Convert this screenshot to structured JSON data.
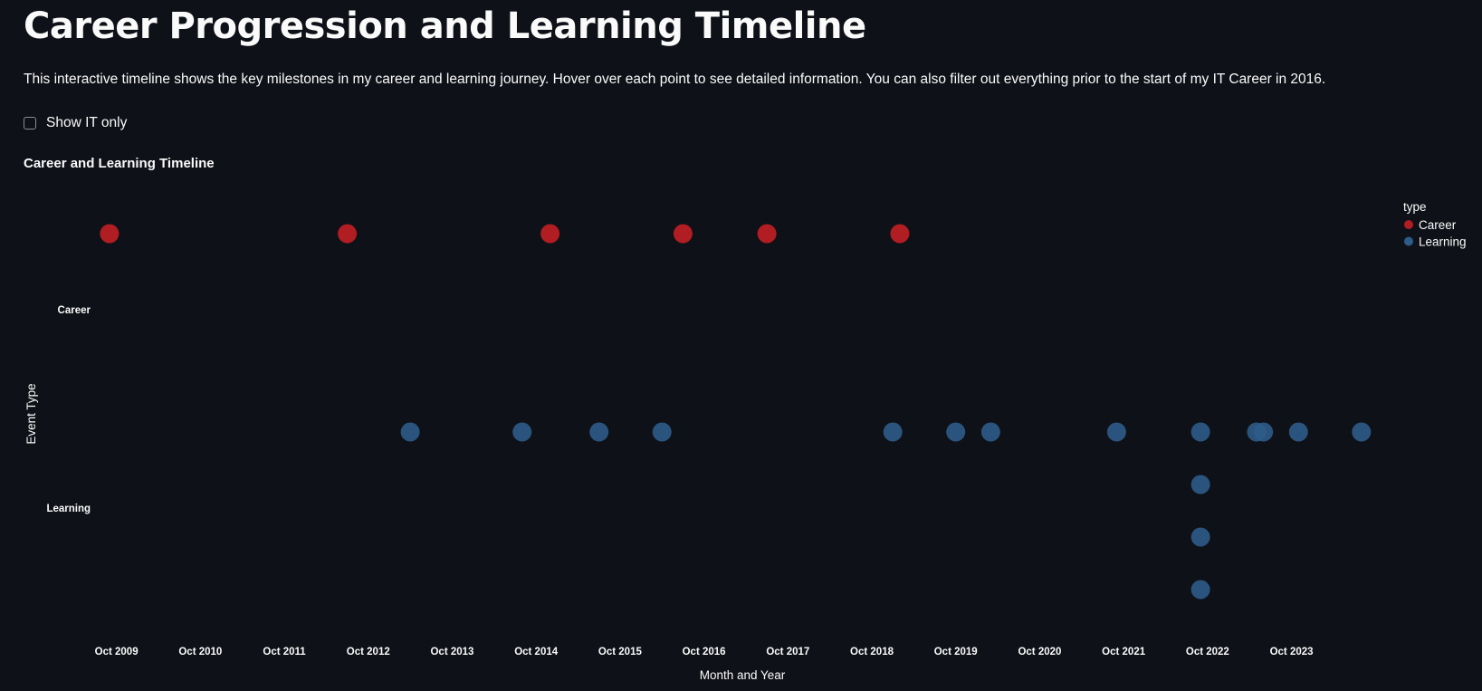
{
  "page": {
    "title": "Career Progression and Learning Timeline",
    "intro": "This interactive timeline shows the key milestones in my career and learning journey. Hover over each point to see detailed information. You can also filter out everything prior to the start of my IT Career in 2016.",
    "filter": {
      "label": "Show IT only",
      "checked": false
    }
  },
  "chart_data": {
    "type": "scatter",
    "title": "Career and Learning Timeline",
    "xlabel": "Month and Year",
    "ylabel": "Event Type",
    "x_ticks": [
      "Oct 2009",
      "Oct 2010",
      "Oct 2011",
      "Oct 2012",
      "Oct 2013",
      "Oct 2014",
      "Oct 2015",
      "Oct 2016",
      "Oct 2017",
      "Oct 2018",
      "Oct 2019",
      "Oct 2020",
      "Oct 2021",
      "Oct 2022",
      "Oct 2023"
    ],
    "xlim": [
      "2009-05",
      "2024-11"
    ],
    "y_categories": [
      "Career",
      "Learning"
    ],
    "grid": false,
    "legend": {
      "title": "type",
      "position": "top-right"
    },
    "series": [
      {
        "name": "Career",
        "color": "#b01d22",
        "points": [
          {
            "x": "2009-09",
            "row": 0
          },
          {
            "x": "2012-07",
            "row": 0
          },
          {
            "x": "2014-12",
            "row": 0
          },
          {
            "x": "2016-07",
            "row": 0
          },
          {
            "x": "2017-07",
            "row": 0
          },
          {
            "x": "2019-02",
            "row": 0
          }
        ]
      },
      {
        "name": "Learning",
        "color": "#2e5c8a",
        "points": [
          {
            "x": "2013-04",
            "row": 0
          },
          {
            "x": "2014-08",
            "row": 0
          },
          {
            "x": "2015-07",
            "row": 0
          },
          {
            "x": "2016-04",
            "row": 0
          },
          {
            "x": "2019-01",
            "row": 0
          },
          {
            "x": "2019-10",
            "row": 0
          },
          {
            "x": "2020-03",
            "row": 0
          },
          {
            "x": "2021-09",
            "row": 0
          },
          {
            "x": "2022-09",
            "row": 0
          },
          {
            "x": "2022-09",
            "row": 1
          },
          {
            "x": "2022-09",
            "row": 2
          },
          {
            "x": "2022-09",
            "row": 3
          },
          {
            "x": "2023-05",
            "row": 0
          },
          {
            "x": "2023-06",
            "row": 0
          },
          {
            "x": "2023-11",
            "row": 0
          },
          {
            "x": "2024-08",
            "row": 0
          }
        ]
      }
    ]
  }
}
